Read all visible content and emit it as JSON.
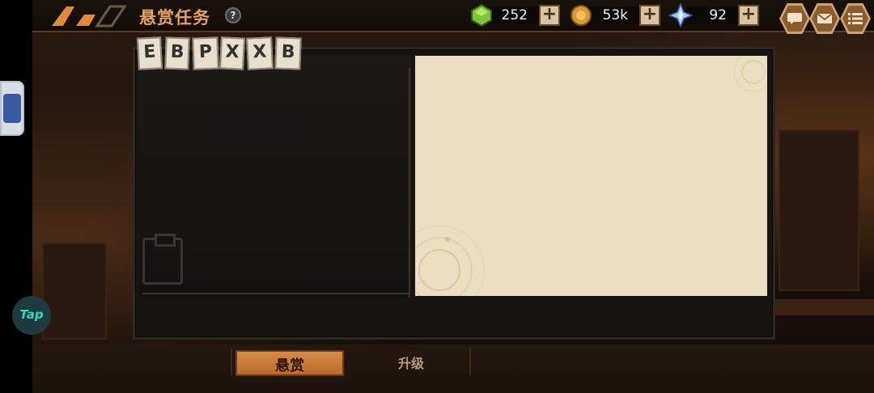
{
  "header": {
    "title": "悬赏任务",
    "help_icon": "?"
  },
  "resources": [
    {
      "name": "green-gem",
      "value": "252"
    },
    {
      "name": "gold-coin",
      "value": "53k"
    },
    {
      "name": "blue-crystal",
      "value": "92"
    }
  ],
  "menu_icons": [
    "chat-icon",
    "mail-icon",
    "menu-list-icon"
  ],
  "board": {
    "stamp_letters": [
      "E",
      "B",
      "P",
      "X",
      "X",
      "B"
    ]
  },
  "tabs": [
    {
      "label": "悬赏",
      "active": true
    },
    {
      "label": "升级",
      "active": false
    }
  ],
  "floating": {
    "tap_label": "Tap"
  },
  "colors": {
    "title": "#e6a25c",
    "active_tab": "#d98c45",
    "paper": "#ecdec0"
  }
}
